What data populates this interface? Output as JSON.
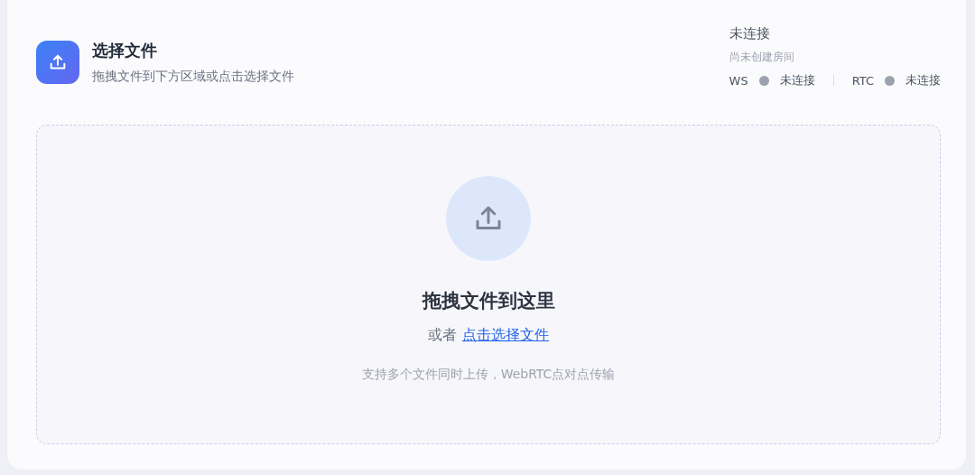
{
  "header": {
    "title": "选择文件",
    "subtitle": "拖拽文件到下方区域或点击选择文件"
  },
  "status": {
    "title": "未连接",
    "room": "尚未创建房间",
    "channels": [
      {
        "name": "WS",
        "connected": false,
        "state": "未连接"
      },
      {
        "name": "RTC",
        "connected": false,
        "state": "未连接"
      }
    ]
  },
  "dropzone": {
    "heading": "拖拽文件到这里",
    "or": "或者",
    "link": "点击选择文件",
    "hint": "支持多个文件同时上传，WebRTC点对点传输"
  }
}
